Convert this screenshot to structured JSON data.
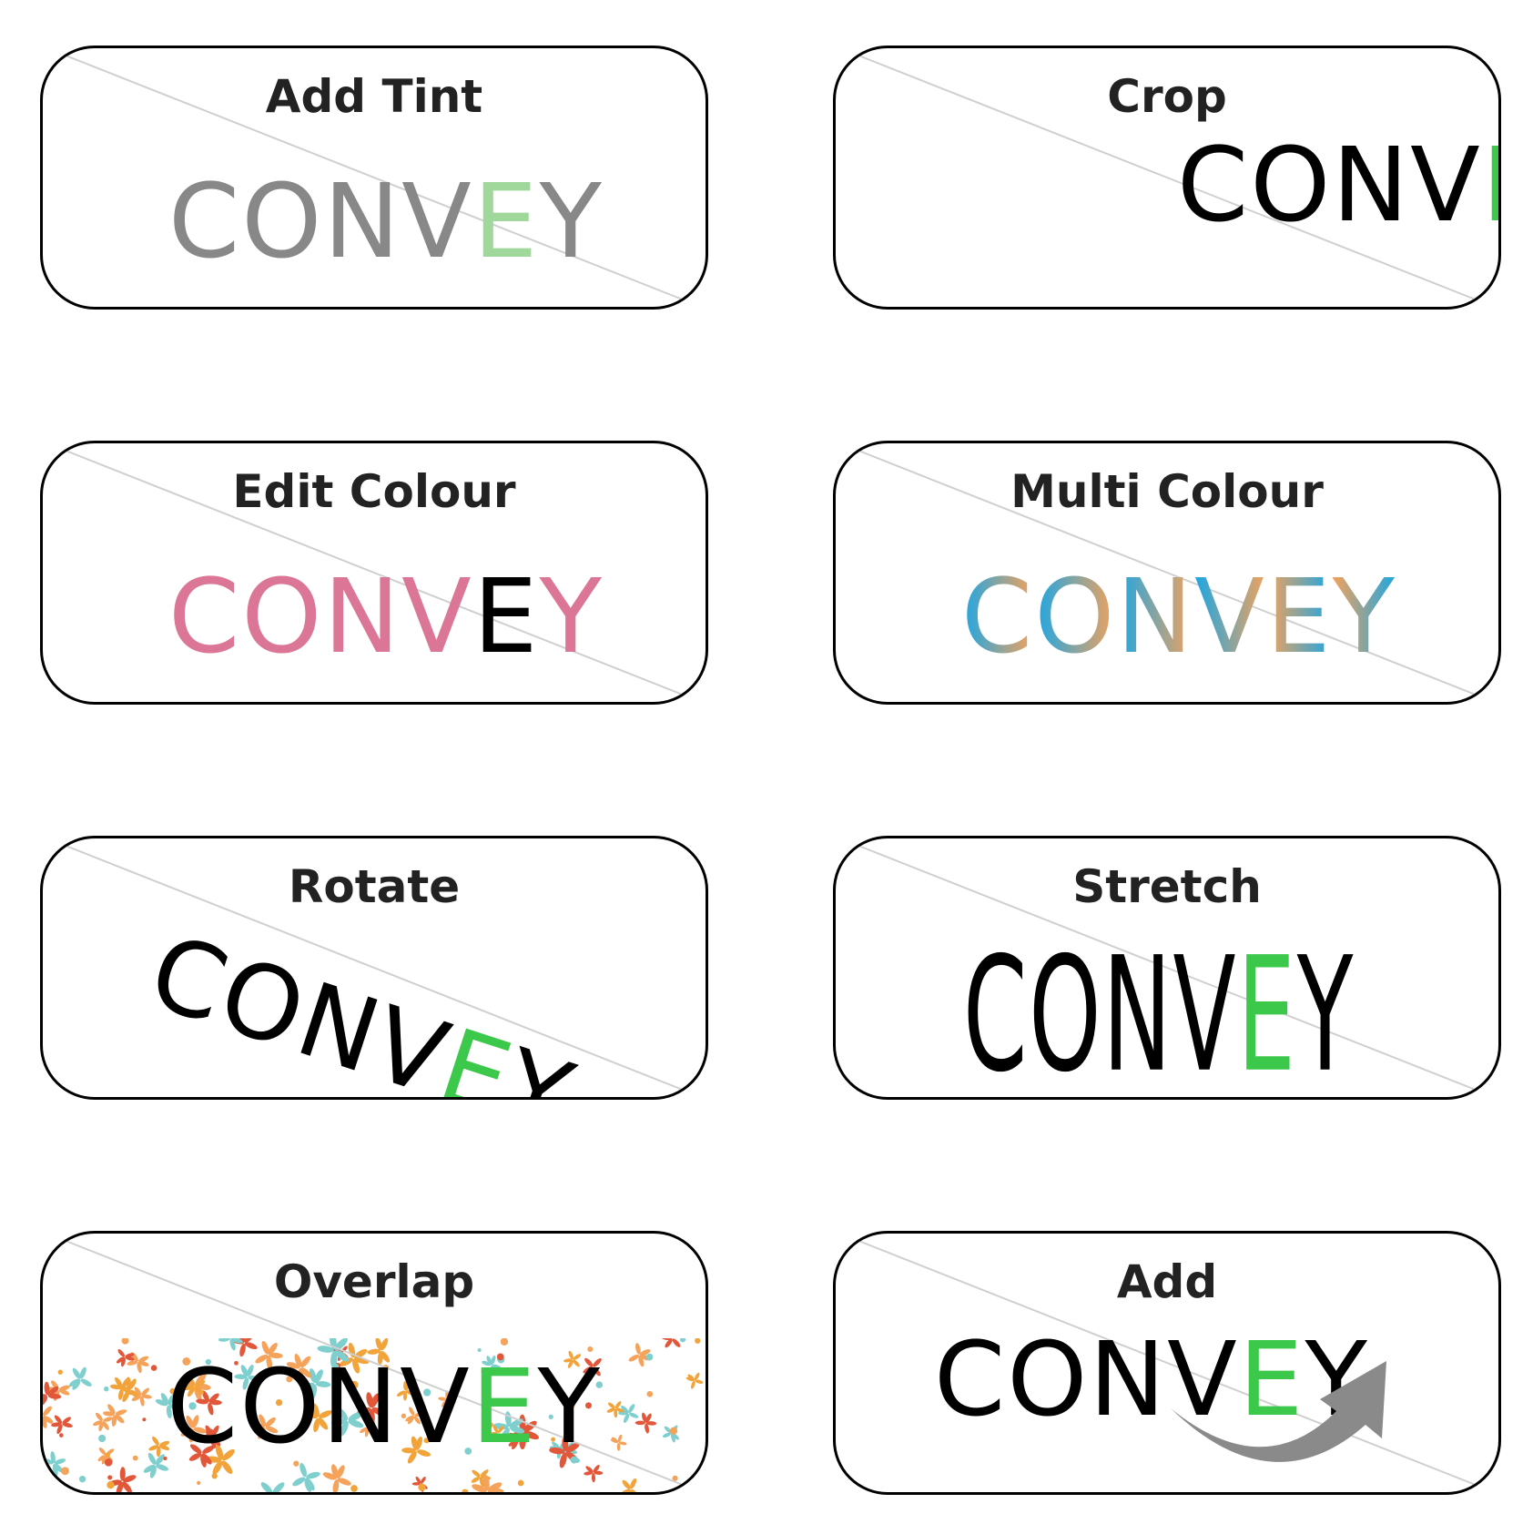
{
  "colors": {
    "black": "#000000",
    "green": "#3cc84a",
    "gray": "#888888",
    "light_green": "#9fd89a",
    "pink": "#dc7696",
    "blue": "#1aa6e6",
    "orange": "#f5a25a",
    "arrow_gray": "#8a8a8a"
  },
  "cards": {
    "add_tint": {
      "title": "Add Tint",
      "letters": [
        "C",
        "O",
        "N",
        "V",
        "E",
        "Y"
      ]
    },
    "crop": {
      "title": "Crop",
      "letters": [
        "C",
        "O",
        "N",
        "V",
        "E"
      ]
    },
    "edit_colour": {
      "title": "Edit Colour",
      "letters": [
        "C",
        "O",
        "N",
        "V",
        "E",
        "Y"
      ]
    },
    "multi_colour": {
      "title": "Multi Colour",
      "letters": [
        "C",
        "O",
        "N",
        "V",
        "E",
        "Y"
      ]
    },
    "rotate": {
      "title": "Rotate",
      "letters": [
        "C",
        "O",
        "N",
        "V",
        "E",
        "Y"
      ]
    },
    "stretch": {
      "title": "Stretch",
      "letters": [
        "C",
        "O",
        "N",
        "V",
        "E",
        "Y"
      ]
    },
    "overlap": {
      "title": "Overlap",
      "letters": [
        "C",
        "O",
        "N",
        "V",
        "E",
        "Y"
      ]
    },
    "add": {
      "title": "Add",
      "letters": [
        "C",
        "O",
        "N",
        "V",
        "E",
        "Y"
      ],
      "icon": "curved-arrow-icon"
    }
  }
}
